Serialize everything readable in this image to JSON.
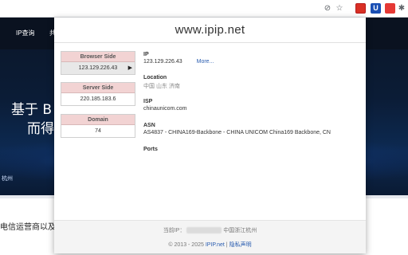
{
  "toolbar": {
    "icons": [
      "no-tracking-icon",
      "star-icon",
      "ipip-extension-icon",
      "u-extension-icon",
      "red-extension-icon",
      "puzzle-icon"
    ]
  },
  "background": {
    "nav_items": [
      "IP查询",
      "共"
    ],
    "headline_line1": "基于 B",
    "headline_line2": "而得",
    "city": "杭州",
    "bottom_text": "电信运营商以及"
  },
  "popup": {
    "title": "www.ipip.net",
    "browser_side": {
      "label": "Browser Side",
      "value": "123.129.226.43"
    },
    "server_side": {
      "label": "Server Side",
      "value": "220.185.183.6"
    },
    "domain": {
      "label": "Domain",
      "value": "74"
    },
    "ip": {
      "label": "IP",
      "value": "123.129.226.43",
      "more": "More..."
    },
    "location": {
      "label": "Location",
      "value": "中国 山东 济南"
    },
    "isp": {
      "label": "ISP",
      "value": "chinaunicom.com"
    },
    "asn": {
      "label": "ASN",
      "value": "AS4837 - CHINA169-Backbone - CHINA UNICOM China169 Backbone, CN"
    },
    "ports": {
      "label": "Ports"
    },
    "footer": {
      "current_ip_prefix": "当前IP：",
      "current_ip_suffix": "中国浙江杭州",
      "copyright": "© 2013 - 2025",
      "site_link": "IPIP.net",
      "separator": "|",
      "privacy_link": "隐私声明"
    }
  }
}
